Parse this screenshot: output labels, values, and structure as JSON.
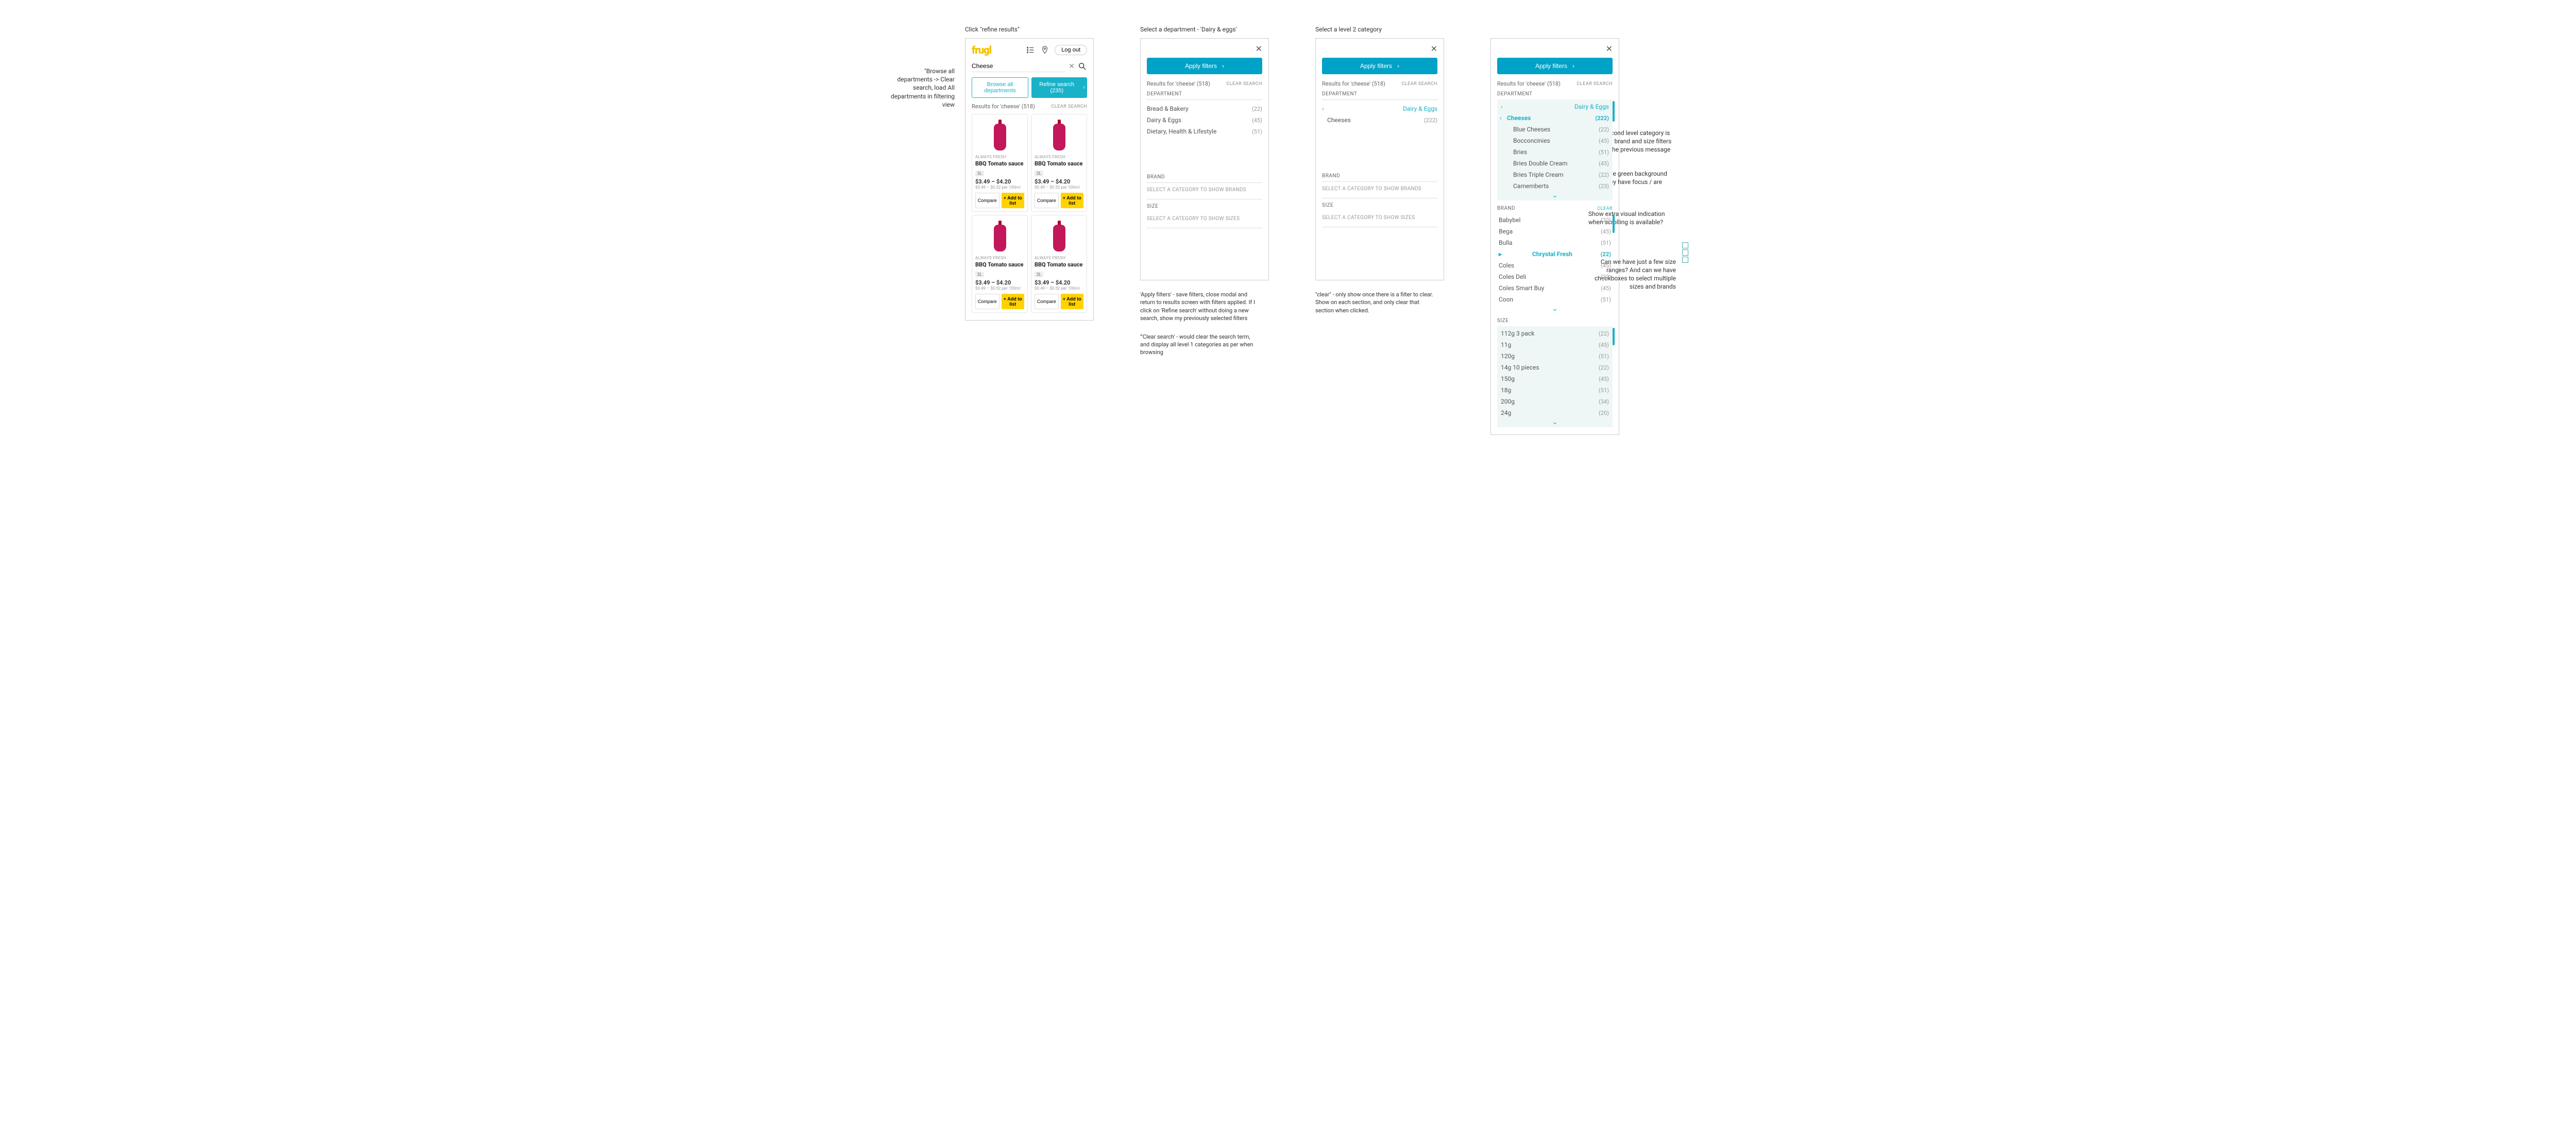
{
  "annotations": {
    "screen1_title": "Click \"refine results\"",
    "screen2_title": "Select a department - 'Dairy & eggs'",
    "screen3_title": "Select a level 2 category",
    "left_note": "\"Browse all departments -> Clear search, load All departments in filtering view",
    "right1": "Once second level category is selected, brand and size filters replace the previous message",
    "right2": "Lists have green background when they have focus / are scrolling",
    "right3": "Show extra visual indication when scrolling is available?",
    "right4": "Can we have just a few size ranges? And can we have checkboxes to select multiple sizes and brands",
    "caption_apply": "'Apply filters' -  save filters, close modal and return to results screen with filters applied. If I click on 'Refine search'  without doing a new search, show my previously selected filters",
    "caption_clearsearch": "'\"Clear search' - would clear the search term, and display all level 1 categories  as per when browsing",
    "caption_clear": "\"clear\" - only show once there is a filter to clear. Show on each section, and only clear that section when clicked."
  },
  "logo": "frugl",
  "logout": "Log out",
  "search_term": "Cheese",
  "browse_label": "Browse all departments",
  "refine_label": "Refine search  (235)",
  "results_label": "Results for 'cheese' (518)",
  "clear_search": "CLEAR SEARCH",
  "apply_filters": "Apply filters",
  "dept_header": "DEPARTMENT",
  "brand_header": "BRAND",
  "size_header": "SIZE",
  "clear_section": "CLEAR",
  "cat_placeholder": "SELECT A CATEGORY TO SHOW BRANDS",
  "size_placeholder": "SELECT A CATEGORY TO SHOW SIZES",
  "departments_s2": [
    {
      "label": "Bread & Bakery",
      "count": "(22)"
    },
    {
      "label": "Dairy & Eggs",
      "count": "(45)"
    },
    {
      "label": "Dietary, Health & Lifestyle",
      "count": "(51)"
    }
  ],
  "s3_parent": "Dairy & Eggs",
  "s3_child": {
    "label": "Cheeses",
    "count": "(222)"
  },
  "s4_parent": "Dairy & Eggs",
  "s4_cat": {
    "label": "Cheeses",
    "count": "(222)"
  },
  "s4_sub": [
    {
      "label": "Blue Cheeses",
      "count": "(22)"
    },
    {
      "label": "Bocconcinies",
      "count": "(45)"
    },
    {
      "label": "Bries",
      "count": "(51)"
    },
    {
      "label": "Bries Double Cream",
      "count": "(45)"
    },
    {
      "label": "Bries Triple Cream",
      "count": "(22)"
    },
    {
      "label": "Camemberts",
      "count": "(23)"
    }
  ],
  "s4_brands": [
    {
      "label": "Babybel",
      "count": "(22)"
    },
    {
      "label": "Bega",
      "count": "(45)"
    },
    {
      "label": "Bulla",
      "count": "(51)"
    },
    {
      "label": "Chrystal Fresh",
      "count": "(22)",
      "active": true
    },
    {
      "label": "Coles",
      "count": "(45)"
    },
    {
      "label": "Coles Deli",
      "count": "(22)"
    },
    {
      "label": "Coles Smart Buy",
      "count": "(45)"
    },
    {
      "label": "Coon",
      "count": "(51)"
    }
  ],
  "s4_sizes": [
    {
      "label": "112g 3 pack",
      "count": "(22)"
    },
    {
      "label": "11g",
      "count": "(45)"
    },
    {
      "label": "120g",
      "count": "(51)"
    },
    {
      "label": "14g 10 pieces",
      "count": "(22)"
    },
    {
      "label": "150g",
      "count": "(45)"
    },
    {
      "label": "18g",
      "count": "(51)"
    },
    {
      "label": "200g",
      "count": "(34)"
    },
    {
      "label": "24g",
      "count": "(20)"
    }
  ],
  "product": {
    "brand": "ALWAYS FRESH",
    "name": "BBQ Tomato sauce",
    "size": "2L",
    "price": "$3.49 – $4.20",
    "unit": "$0.49 – $0.52 per 100ml",
    "compare": "Compare",
    "add": "+ Add to list"
  }
}
